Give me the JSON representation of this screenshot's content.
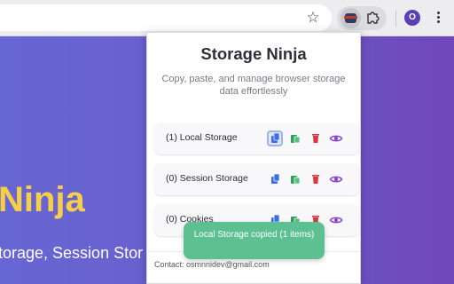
{
  "browser": {
    "star_glyph": "☆",
    "profile_initial": "O",
    "extension_icons": [
      "storage-ninja-icon",
      "puzzle-icon"
    ]
  },
  "background_page": {
    "hero_title": "Ninja",
    "hero_subtitle": "torage, Session Stor"
  },
  "popup": {
    "title": "Storage Ninja",
    "subtitle": "Copy, paste, and manage browser storage data effortlessly",
    "rows": [
      {
        "label": "(1) Local Storage"
      },
      {
        "label": "(0) Session Storage"
      },
      {
        "label": "(0) Cookies"
      }
    ],
    "footer": "Contact: osmnnidev@gmail.com"
  },
  "toast": {
    "message": "Local Storage copied (1 items)"
  },
  "colors": {
    "copy": "#3b6fe0",
    "paste": "#2f9e5b",
    "delete": "#e0353b",
    "view": "#8a3fd1",
    "toast": "#5cc091",
    "hero_title": "#f6cf46"
  }
}
